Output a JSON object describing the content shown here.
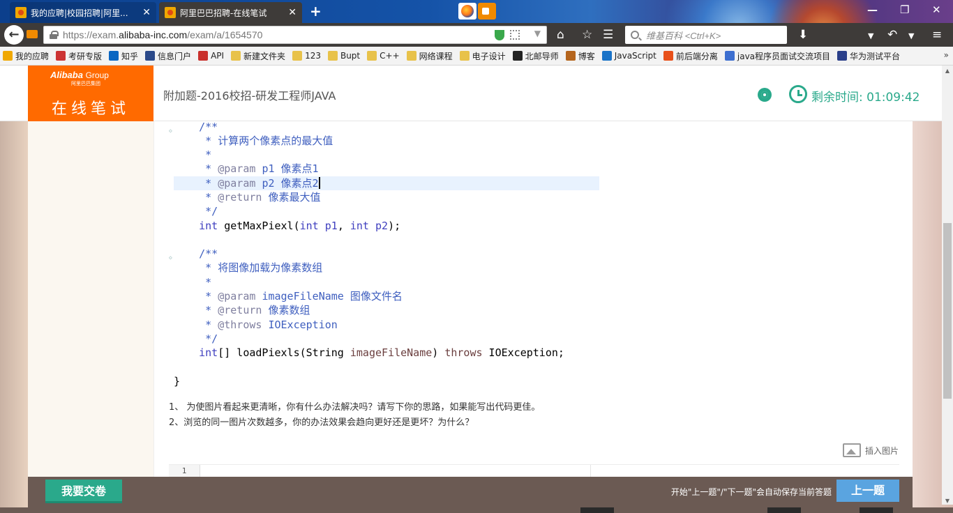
{
  "browser": {
    "tabs": [
      {
        "title": "我的应聘|校园招聘|阿里...",
        "active": false
      },
      {
        "title": "阿里巴巴招聘-在线笔试",
        "active": true
      }
    ],
    "url_prefix": "https://exam.",
    "url_domain": "alibaba-inc.com",
    "url_path": "/exam/a/1654570",
    "search_placeholder": "维基百科 <Ctrl+K>",
    "bookmarks": [
      {
        "label": "我的应聘",
        "icon": "alibaba-icon",
        "color": "#f0a800"
      },
      {
        "label": "考研专版",
        "icon": "flag-icon",
        "color": "#cc3333"
      },
      {
        "label": "知乎",
        "icon": "zhihu-icon",
        "color": "#0a66c2"
      },
      {
        "label": "信息门户",
        "icon": "globe-icon",
        "color": "#2b4a8a"
      },
      {
        "label": "API",
        "icon": "api-icon",
        "color": "#c9302c"
      },
      {
        "label": "新建文件夹",
        "icon": "folder-icon",
        "color": "#e8c24a"
      },
      {
        "label": "123",
        "icon": "folder-icon",
        "color": "#e8c24a"
      },
      {
        "label": "Bupt",
        "icon": "folder-icon",
        "color": "#e8c24a"
      },
      {
        "label": "C++",
        "icon": "folder-icon",
        "color": "#e8c24a"
      },
      {
        "label": "网络课程",
        "icon": "folder-icon",
        "color": "#e8c24a"
      },
      {
        "label": "电子设计",
        "icon": "folder-icon",
        "color": "#e8c24a"
      },
      {
        "label": "北邮导师",
        "icon": "github-icon",
        "color": "#222222"
      },
      {
        "label": "博客",
        "icon": "deer-icon",
        "color": "#b5651d"
      },
      {
        "label": "JavaScript",
        "icon": "book-icon",
        "color": "#1a73c8"
      },
      {
        "label": "前后端分离",
        "icon": "e-icon",
        "color": "#e8501a"
      },
      {
        "label": "java程序员面试交流项目",
        "icon": "paw-icon",
        "color": "#3d6fd0"
      },
      {
        "label": "华为测试平台",
        "icon": "oj-icon",
        "color": "#2a3f8a"
      }
    ]
  },
  "header": {
    "brand_logo": "Alibaba",
    "brand_group": "Group",
    "brand_logo_sub": "阿里巴巴集团",
    "brand_title": "在线笔试",
    "exam_title": "附加题-2016校招-研发工程师JAVA",
    "timer_label": "剩余时间: 01:09:42",
    "accent_color": "#ff6a00",
    "status_color": "#2aa98b"
  },
  "code": {
    "l1": "/**",
    "l2": " * 计算两个像素点的最大值",
    "l3": " *",
    "l4_tag": "@param",
    "l4_name": "p1",
    "l4_desc": "像素点1",
    "l5_tag": "@param",
    "l5_name": "p2",
    "l5_desc": "像素点2",
    "l6_tag": "@return",
    "l6_desc": "像素最大值",
    "l7": " */",
    "l8_kw": "int",
    "l8_rest": "getMaxPiexl(",
    "l8_kw2": "int",
    "l8_p1": "p1",
    "l8_kw3": "int",
    "l8_p2": "p2",
    "l8_end": ");",
    "l10": "/**",
    "l11": " * 将图像加载为像素数组",
    "l12": " *",
    "l13_tag": "@param",
    "l13_name": "imageFileName",
    "l13_desc": "图像文件名",
    "l14_tag": "@return",
    "l14_desc": "像素数组",
    "l15_tag": "@throws",
    "l15_name": "IOException",
    "l16": " */",
    "l17_kw": "int",
    "l17_rest": "[] loadPiexls(String ",
    "l17_param": "imageFileName",
    "l17_close": ") ",
    "l17_throws": "throws",
    "l17_end": " IOException;",
    "closing_brace": "}"
  },
  "questions": [
    "1、 为使图片看起来更清晰，你有什么办法解决吗？请写下你的思路，如果能写出代码更佳。",
    "2、浏览的同一图片次数越多，你的办法效果会趋向更好还是更坏？为什么？"
  ],
  "insert_image_label": "插入图片",
  "answer_line_number": "1",
  "footer": {
    "submit_label": "我要交卷",
    "autosave_note": "开始\"上一题\"/\"下一题\"会自动保存当前答题",
    "prev_label": "上一题"
  }
}
